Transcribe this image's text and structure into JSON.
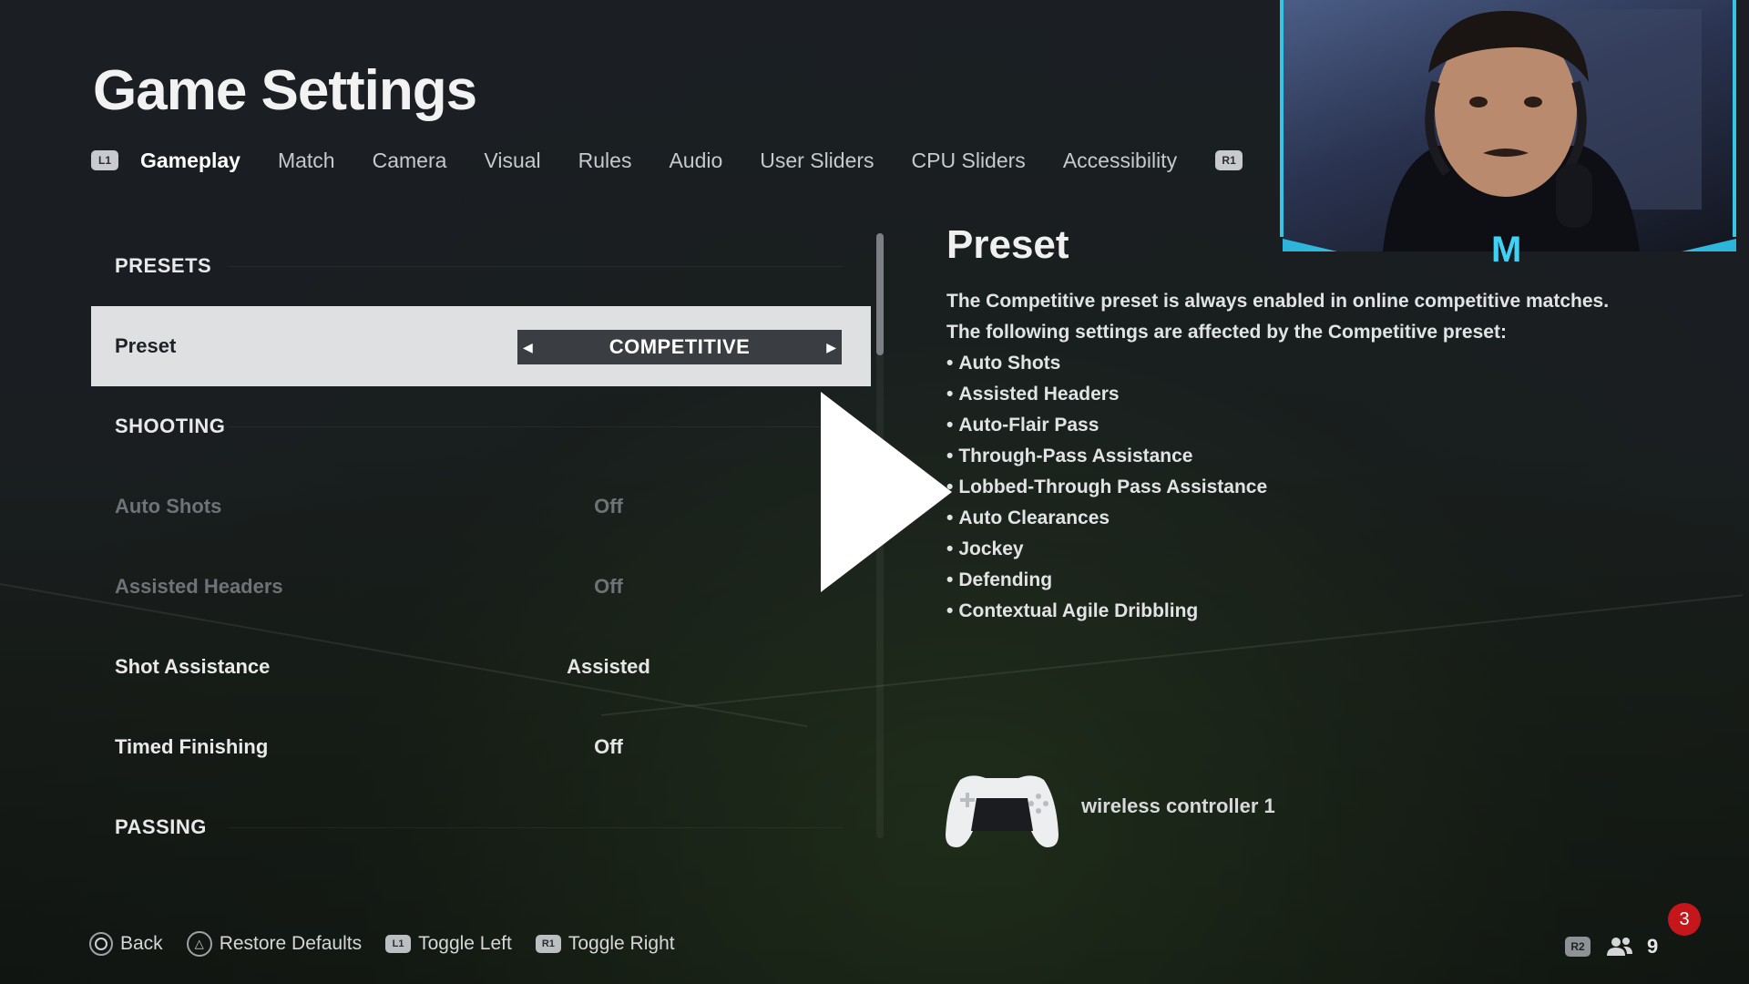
{
  "title": "Game Settings",
  "tabs": {
    "left_button": "L1",
    "right_button": "R1",
    "items": [
      "Gameplay",
      "Match",
      "Camera",
      "Visual",
      "Rules",
      "Audio",
      "User Sliders",
      "CPU Sliders",
      "Accessibility"
    ],
    "active_index": 0
  },
  "settings": {
    "sections": {
      "presets": "PRESETS",
      "shooting": "SHOOTING",
      "passing": "PASSING"
    },
    "rows": [
      {
        "label": "Preset",
        "value": "COMPETITIVE",
        "selected": true
      },
      {
        "label": "Auto Shots",
        "value": "Off",
        "disabled": true
      },
      {
        "label": "Assisted Headers",
        "value": "Off",
        "disabled": true
      },
      {
        "label": "Shot Assistance",
        "value": "Assisted"
      },
      {
        "label": "Timed Finishing",
        "value": "Off"
      }
    ]
  },
  "description": {
    "title": "Preset",
    "line1": "The Competitive preset is always enabled in online competitive matches.",
    "line2": "The following settings are affected by the Competitive preset:",
    "bullet": "•",
    "items": [
      "Auto Shots",
      "Assisted Headers",
      "Auto-Flair Pass",
      "Through-Pass Assistance",
      "Lobbed-Through Pass Assistance",
      "Auto Clearances",
      "Jockey",
      "Defending",
      "Contextual Agile Dribbling"
    ]
  },
  "controller": {
    "label": "wireless controller 1",
    "icon": "controller-icon"
  },
  "footer": {
    "hints": [
      {
        "button": "circle",
        "label": "Back"
      },
      {
        "button": "triangle",
        "label": "Restore Defaults"
      },
      {
        "button": "L1",
        "label": "Toggle Left"
      },
      {
        "button": "R1",
        "label": "Toggle Right"
      }
    ],
    "r2_label": "R2",
    "players_count": "9",
    "notification_count": "3"
  },
  "webcam": {
    "logo": "M"
  },
  "colors": {
    "accent_cyan": "#37c4e6",
    "selected_row": "#dfe0e1",
    "notification": "#c5161c"
  }
}
